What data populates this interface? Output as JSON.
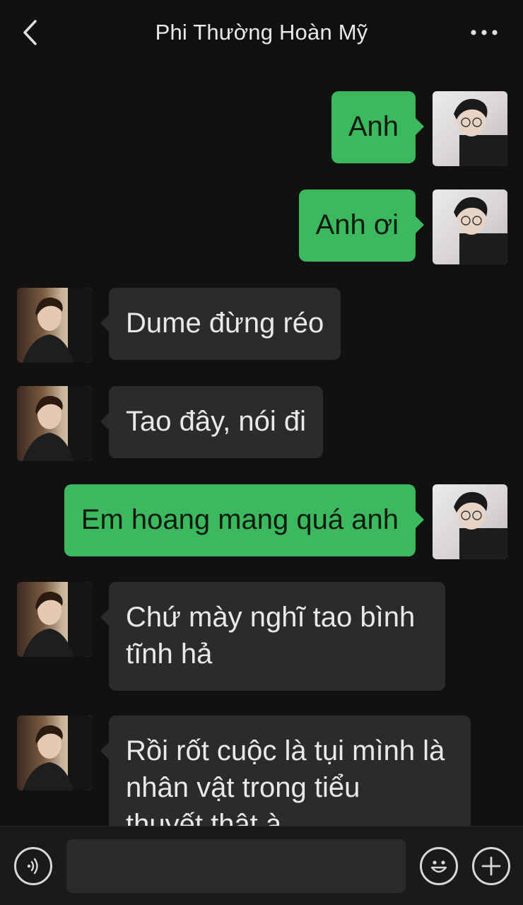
{
  "header": {
    "title": "Phi Thường Hoàn Mỹ",
    "back_icon": "chevron-left-icon",
    "more_icon": "more-dots-icon"
  },
  "messages": [
    {
      "sender": "me",
      "text": "Anh"
    },
    {
      "sender": "me",
      "text": "Anh ơi"
    },
    {
      "sender": "other",
      "text": "Dume đừng réo"
    },
    {
      "sender": "other",
      "text": "Tao đây, nói đi"
    },
    {
      "sender": "me",
      "text": "Em hoang mang quá anh"
    },
    {
      "sender": "other",
      "text": "Chứ mày nghĩ tao bình\ntĩnh hả"
    },
    {
      "sender": "other",
      "text": "Rồi rốt cuộc là tụi mình là\nnhân vật trong tiểu\nthuyết thật à"
    }
  ],
  "composer": {
    "voice_icon": "voice-icon",
    "emoji_icon": "emoji-icon",
    "add_icon": "plus-icon",
    "input_value": ""
  },
  "colors": {
    "background": "#111111",
    "my_bubble": "#3cb95f",
    "other_bubble": "#2b2b2b"
  }
}
